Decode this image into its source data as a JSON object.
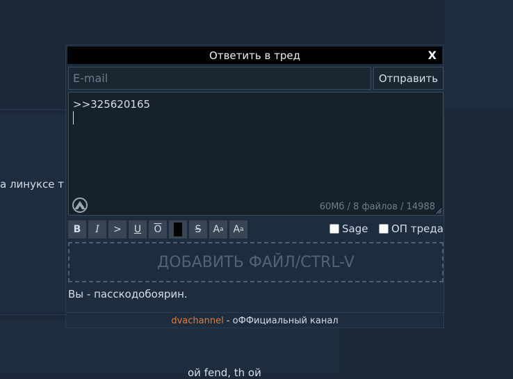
{
  "background": {
    "post_text_1": "а линуксе т",
    "post_text_2": "ой fend, th ой"
  },
  "modal": {
    "title": "Ответить в тред",
    "close_label": "X",
    "email_placeholder": "E-mail",
    "email_value": "",
    "send_label": "Отправить",
    "message_text": ">>325620165",
    "limits": "60Мб / 8 файлов / 14988"
  },
  "toolbar": {
    "bold": "B",
    "italic": "I",
    "quote": ">",
    "underline": "U",
    "overline": "O",
    "strike": "S",
    "sup_main": "A",
    "sup_small": "a",
    "sub_main": "A",
    "sub_small": "a",
    "black_color": "#000000"
  },
  "options": {
    "sage_label": "Sage",
    "op_label": "ОП треда"
  },
  "dropzone_label": "ДОБАВИТЬ ФАЙЛ/CTRL-V",
  "status_text": "Вы - пасскодобоярин.",
  "footer": {
    "link_text": "dvachannel",
    "rest_text": " - оФФициальный канал"
  },
  "colors": {
    "background": "#1b2838",
    "panel": "#1e2d3d",
    "accent_link": "#e07b3a"
  }
}
